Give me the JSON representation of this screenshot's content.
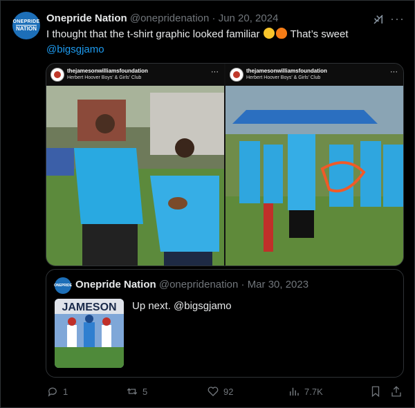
{
  "tweet": {
    "avatar": {
      "line1": "ONEPRIDE",
      "line2": "NATION"
    },
    "name": "Onepride Nation",
    "handle": "@onepridenation",
    "separator": "·",
    "date": "Jun 20, 2024",
    "text_before": "I thought that the t-shirt graphic looked familiar",
    "text_after": "That’s sweet",
    "mention": "@bigsgjamo",
    "emoji": [
      "laughing-face",
      "fire"
    ]
  },
  "media": [
    {
      "username": "thejamesonwilliamsfoundation",
      "location": "Herbert Hoover Boys' & Girls' Club"
    },
    {
      "username": "thejamesonwilliamsfoundation",
      "location": "Herbert Hoover Boys' & Girls' Club"
    }
  ],
  "quote": {
    "avatar": "ONEPRIDE",
    "name": "Onepride Nation",
    "handle": "@onepridenation",
    "separator": "·",
    "date": "Mar 30, 2023",
    "text": "Up next. @bigsgjamo",
    "thumb_title": "JAMESON"
  },
  "actions": {
    "replies": "1",
    "reposts": "5",
    "likes": "92",
    "views": "7.7K"
  },
  "colors": {
    "accent": "#1d9bf0",
    "muted": "#71767b",
    "background": "#000000"
  }
}
